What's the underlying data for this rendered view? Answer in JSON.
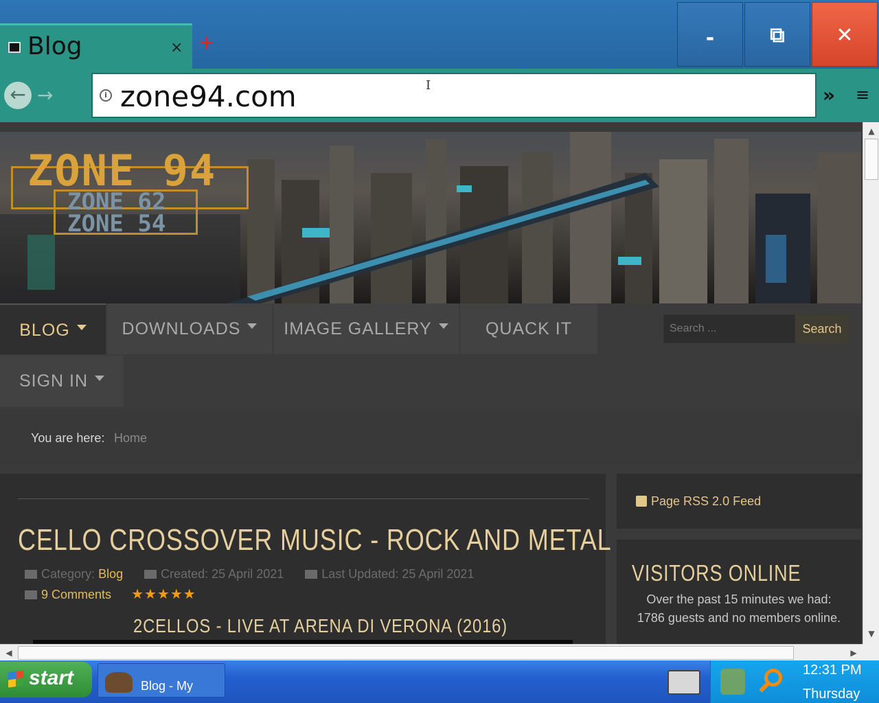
{
  "browser": {
    "tab": {
      "title": "Blog",
      "close_glyph": "×",
      "favicon": "page-icon"
    },
    "new_tab_glyph": "+",
    "window_buttons": {
      "minimize": "-",
      "restore": "⧉",
      "close": "✕"
    },
    "back_glyph": "←",
    "forward_glyph": "→",
    "url": "zone94.com",
    "info_glyph": "i",
    "more_glyph": "»",
    "menu_glyph": "≡",
    "text_cursor_glyph": "I"
  },
  "site": {
    "logo": {
      "main": "ZONE 94",
      "sub1": "ZONE 62",
      "sub2": "ZONE 54"
    },
    "nav": [
      {
        "label": "BLOG",
        "has_caret": true,
        "active": true
      },
      {
        "label": "DOWNLOADS",
        "has_caret": true
      },
      {
        "label": "IMAGE GALLERY",
        "has_caret": true
      },
      {
        "label": "QUACK IT",
        "has_caret": false
      },
      {
        "label": "SIGN IN",
        "has_caret": true
      }
    ],
    "search": {
      "placeholder": "Search ...",
      "button": "Search"
    },
    "breadcrumb": {
      "label": "You are here:",
      "home": "Home"
    },
    "article": {
      "title": "CELLO CROSSOVER MUSIC - ROCK AND METAL",
      "category_label": "Category:",
      "category": "Blog",
      "created": "Created: 25 April 2021",
      "updated": "Last Updated: 25 April 2021",
      "comments": "9 Comments",
      "rating_stars": "★★★★★",
      "subtitle": "2CELLOS - LIVE AT ARENA DI VERONA (2016)"
    },
    "sidebar": {
      "rss": "Page RSS 2.0 Feed",
      "visitors_title": "VISITORS ONLINE",
      "visitors_text": "Over the past 15 minutes we had: 1786 guests and no members online."
    }
  },
  "scrollbars": {
    "up": "▲",
    "down": "▼",
    "left": "◀",
    "right": "▶",
    "grip": "|||"
  },
  "taskbar": {
    "start": "start",
    "task_label": "Blog - My",
    "clock_time": "12:31 PM",
    "clock_day": "Thursday"
  },
  "colors": {
    "accent": "#2a9486",
    "nav_active": "#e7c98d",
    "link": "#e3bb5a",
    "stars": "#f39c12"
  }
}
